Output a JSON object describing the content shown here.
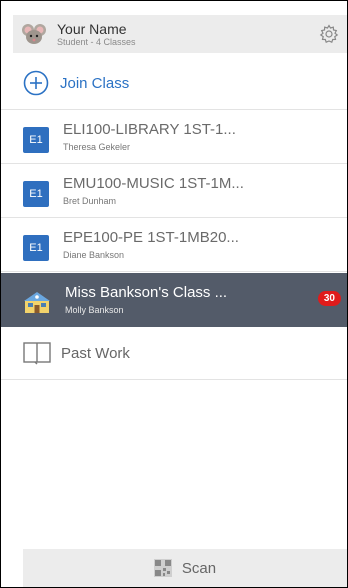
{
  "header": {
    "name": "Your Name",
    "subtitle": "Student - 4 Classes",
    "avatar_icon": "mouse-avatar-icon",
    "settings_icon": "gear-icon"
  },
  "join": {
    "label": "Join Class",
    "icon": "plus-circle-icon"
  },
  "classes": [
    {
      "badge": "E1",
      "title": "ELI100-LIBRARY 1ST-1...",
      "teacher": "Theresa Gekeler"
    },
    {
      "badge": "E1",
      "title": "EMU100-MUSIC 1ST-1M...",
      "teacher": "Bret Dunham"
    },
    {
      "badge": "E1",
      "title": "EPE100-PE 1ST-1MB20...",
      "teacher": "Diane Bankson"
    },
    {
      "badge": "house-icon",
      "title": "Miss Bankson's Class ...",
      "teacher": "Molly Bankson",
      "count": "30",
      "selected": true
    }
  ],
  "past_work": {
    "label": "Past Work",
    "icon": "book-icon"
  },
  "scan": {
    "label": "Scan",
    "icon": "qr-code-icon"
  },
  "colors": {
    "accent": "#2b72c4",
    "badge": "#2f6fbf",
    "selected_bg": "#535b69",
    "notification": "#e01b1b"
  }
}
